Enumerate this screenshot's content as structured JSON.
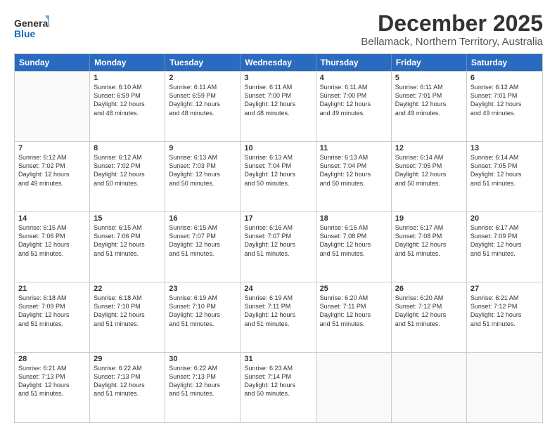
{
  "logo": {
    "general": "General",
    "blue": "Blue"
  },
  "title": "December 2025",
  "subtitle": "Bellamack, Northern Territory, Australia",
  "header_days": [
    "Sunday",
    "Monday",
    "Tuesday",
    "Wednesday",
    "Thursday",
    "Friday",
    "Saturday"
  ],
  "weeks": [
    [
      {
        "day": "",
        "info": ""
      },
      {
        "day": "1",
        "info": "Sunrise: 6:10 AM\nSunset: 6:59 PM\nDaylight: 12 hours\nand 48 minutes."
      },
      {
        "day": "2",
        "info": "Sunrise: 6:11 AM\nSunset: 6:59 PM\nDaylight: 12 hours\nand 48 minutes."
      },
      {
        "day": "3",
        "info": "Sunrise: 6:11 AM\nSunset: 7:00 PM\nDaylight: 12 hours\nand 48 minutes."
      },
      {
        "day": "4",
        "info": "Sunrise: 6:11 AM\nSunset: 7:00 PM\nDaylight: 12 hours\nand 49 minutes."
      },
      {
        "day": "5",
        "info": "Sunrise: 6:11 AM\nSunset: 7:01 PM\nDaylight: 12 hours\nand 49 minutes."
      },
      {
        "day": "6",
        "info": "Sunrise: 6:12 AM\nSunset: 7:01 PM\nDaylight: 12 hours\nand 49 minutes."
      }
    ],
    [
      {
        "day": "7",
        "info": "Sunrise: 6:12 AM\nSunset: 7:02 PM\nDaylight: 12 hours\nand 49 minutes."
      },
      {
        "day": "8",
        "info": "Sunrise: 6:12 AM\nSunset: 7:02 PM\nDaylight: 12 hours\nand 50 minutes."
      },
      {
        "day": "9",
        "info": "Sunrise: 6:13 AM\nSunset: 7:03 PM\nDaylight: 12 hours\nand 50 minutes."
      },
      {
        "day": "10",
        "info": "Sunrise: 6:13 AM\nSunset: 7:04 PM\nDaylight: 12 hours\nand 50 minutes."
      },
      {
        "day": "11",
        "info": "Sunrise: 6:13 AM\nSunset: 7:04 PM\nDaylight: 12 hours\nand 50 minutes."
      },
      {
        "day": "12",
        "info": "Sunrise: 6:14 AM\nSunset: 7:05 PM\nDaylight: 12 hours\nand 50 minutes."
      },
      {
        "day": "13",
        "info": "Sunrise: 6:14 AM\nSunset: 7:05 PM\nDaylight: 12 hours\nand 51 minutes."
      }
    ],
    [
      {
        "day": "14",
        "info": "Sunrise: 6:15 AM\nSunset: 7:06 PM\nDaylight: 12 hours\nand 51 minutes."
      },
      {
        "day": "15",
        "info": "Sunrise: 6:15 AM\nSunset: 7:06 PM\nDaylight: 12 hours\nand 51 minutes."
      },
      {
        "day": "16",
        "info": "Sunrise: 6:15 AM\nSunset: 7:07 PM\nDaylight: 12 hours\nand 51 minutes."
      },
      {
        "day": "17",
        "info": "Sunrise: 6:16 AM\nSunset: 7:07 PM\nDaylight: 12 hours\nand 51 minutes."
      },
      {
        "day": "18",
        "info": "Sunrise: 6:16 AM\nSunset: 7:08 PM\nDaylight: 12 hours\nand 51 minutes."
      },
      {
        "day": "19",
        "info": "Sunrise: 6:17 AM\nSunset: 7:08 PM\nDaylight: 12 hours\nand 51 minutes."
      },
      {
        "day": "20",
        "info": "Sunrise: 6:17 AM\nSunset: 7:09 PM\nDaylight: 12 hours\nand 51 minutes."
      }
    ],
    [
      {
        "day": "21",
        "info": "Sunrise: 6:18 AM\nSunset: 7:09 PM\nDaylight: 12 hours\nand 51 minutes."
      },
      {
        "day": "22",
        "info": "Sunrise: 6:18 AM\nSunset: 7:10 PM\nDaylight: 12 hours\nand 51 minutes."
      },
      {
        "day": "23",
        "info": "Sunrise: 6:19 AM\nSunset: 7:10 PM\nDaylight: 12 hours\nand 51 minutes."
      },
      {
        "day": "24",
        "info": "Sunrise: 6:19 AM\nSunset: 7:11 PM\nDaylight: 12 hours\nand 51 minutes."
      },
      {
        "day": "25",
        "info": "Sunrise: 6:20 AM\nSunset: 7:11 PM\nDaylight: 12 hours\nand 51 minutes."
      },
      {
        "day": "26",
        "info": "Sunrise: 6:20 AM\nSunset: 7:12 PM\nDaylight: 12 hours\nand 51 minutes."
      },
      {
        "day": "27",
        "info": "Sunrise: 6:21 AM\nSunset: 7:12 PM\nDaylight: 12 hours\nand 51 minutes."
      }
    ],
    [
      {
        "day": "28",
        "info": "Sunrise: 6:21 AM\nSunset: 7:13 PM\nDaylight: 12 hours\nand 51 minutes."
      },
      {
        "day": "29",
        "info": "Sunrise: 6:22 AM\nSunset: 7:13 PM\nDaylight: 12 hours\nand 51 minutes."
      },
      {
        "day": "30",
        "info": "Sunrise: 6:22 AM\nSunset: 7:13 PM\nDaylight: 12 hours\nand 51 minutes."
      },
      {
        "day": "31",
        "info": "Sunrise: 6:23 AM\nSunset: 7:14 PM\nDaylight: 12 hours\nand 50 minutes."
      },
      {
        "day": "",
        "info": ""
      },
      {
        "day": "",
        "info": ""
      },
      {
        "day": "",
        "info": ""
      }
    ]
  ]
}
